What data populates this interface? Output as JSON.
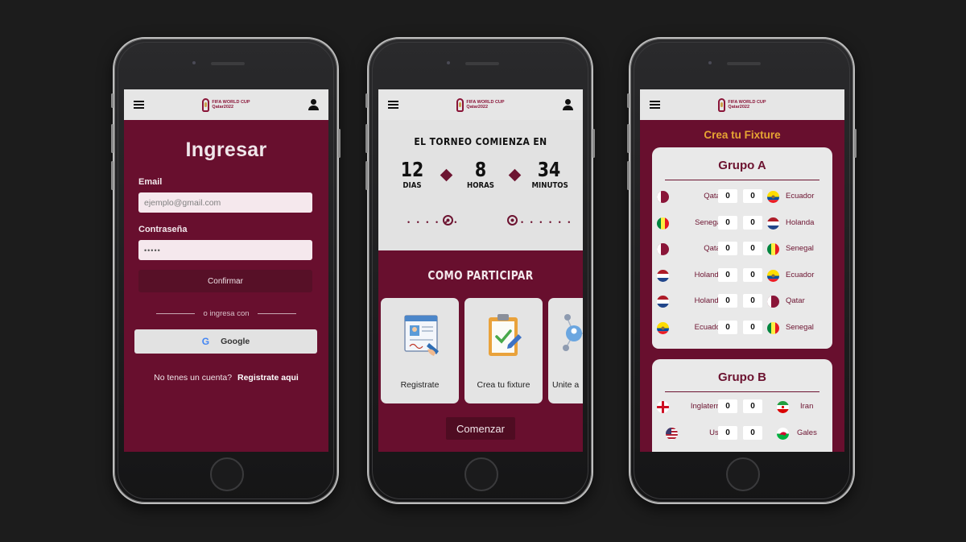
{
  "brand": {
    "logo_line1": "FIFA WORLD CUP",
    "logo_line2": "Qatar2022"
  },
  "login": {
    "title": "Ingresar",
    "email_label": "Email",
    "email_placeholder": "ejemplo@gmail.com",
    "password_label": "Contraseña",
    "password_value": "•••••",
    "confirm_label": "Confirmar",
    "divider_text": "o ingresa con",
    "google_label": "Google",
    "signup_text": "No tenes un cuenta?",
    "signup_link": "Registrate aqui"
  },
  "home": {
    "countdown_title": "EL TORNEO COMIENZA EN",
    "countdown": [
      {
        "value": "12",
        "unit": "DIAS"
      },
      {
        "value": "8",
        "unit": "HORAS"
      },
      {
        "value": "34",
        "unit": "MINUTOS"
      }
    ],
    "dots": "• • • • • •",
    "how_title": "COMO PARTICIPAR",
    "cards": [
      {
        "label": "Registrate"
      },
      {
        "label": "Crea tu fixture"
      },
      {
        "label": "Unite a"
      }
    ],
    "start_label": "Comenzar"
  },
  "fixture": {
    "title": "Crea tu Fixture",
    "groups": [
      {
        "name": "Grupo A",
        "matches": [
          {
            "home": "Qatar",
            "away": "Ecuador",
            "home_score": "0",
            "away_score": "0"
          },
          {
            "home": "Senegal",
            "away": "Holanda",
            "home_score": "0",
            "away_score": "0"
          },
          {
            "home": "Qatar",
            "away": "Senegal",
            "home_score": "0",
            "away_score": "0"
          },
          {
            "home": "Holanda",
            "away": "Ecuador",
            "home_score": "0",
            "away_score": "0"
          },
          {
            "home": "Holanda",
            "away": "Qatar",
            "home_score": "0",
            "away_score": "0"
          },
          {
            "home": "Ecuador",
            "away": "Senegal",
            "home_score": "0",
            "away_score": "0"
          }
        ]
      },
      {
        "name": "Grupo B",
        "matches": [
          {
            "home": "Inglaterra",
            "away": "Iran",
            "home_score": "0",
            "away_score": "0"
          },
          {
            "home": "Usa",
            "away": "Gales",
            "home_score": "0",
            "away_score": "0"
          }
        ]
      }
    ]
  },
  "colors": {
    "primary": "#680f2e",
    "accent": "#e6a533",
    "button_dark": "#571027"
  }
}
